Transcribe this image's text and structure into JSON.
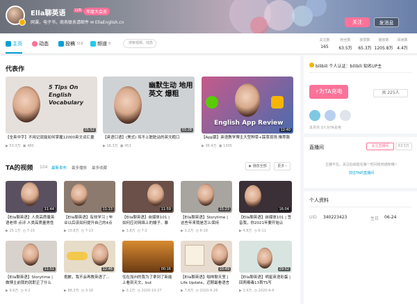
{
  "header": {
    "username": "Ella聊英语",
    "level": "LV6",
    "vip": "年度大会员",
    "bio": "网课，电子书，商务联系请邮件 ✉ EllaEnglish.cn",
    "follow_label": "关注",
    "message_label": "发消息"
  },
  "nav": {
    "tabs": [
      {
        "label": "主页",
        "count": ""
      },
      {
        "label": "动态",
        "count": ""
      },
      {
        "label": "投稿",
        "count": "318"
      },
      {
        "label": "频道",
        "count": "8"
      }
    ],
    "search_placeholder": "搜索视频、动态",
    "stats": [
      {
        "key": "关注数",
        "value": "165"
      },
      {
        "key": "粉丝数",
        "value": "63.5万"
      },
      {
        "key": "获赞数",
        "value": "65.3万"
      },
      {
        "key": "播放数",
        "value": "1205.8万"
      },
      {
        "key": "阅读数",
        "value": "4.4万"
      }
    ]
  },
  "featured": {
    "heading": "代表作",
    "items": [
      {
        "overlay": "5 Tips On English Vocabulary",
        "duration": "05:52",
        "title": "【全英中字】不用记就能如何掌握12000英文词汇量",
        "plays": "53.3万",
        "comments": "480"
      },
      {
        "overlay": "幽默生动 地用英文 爆粗",
        "duration": "03:28",
        "title": "【英语口语】(美式) 骂不上脏脏话的英文粗口",
        "plays": "16.3万",
        "comments": "453"
      },
      {
        "overlay": "English App Review",
        "duration": "12:40",
        "title": "【App篇】英语教学博主大型种草+踩草现场 推荐款",
        "plays": "36.4万",
        "comments": "1305"
      }
    ]
  },
  "videos": {
    "heading": "TA的视频",
    "count": "104",
    "tabs": [
      "最新发布",
      "最多播放",
      "最多收藏"
    ],
    "play_all": "▶ 播放全部",
    "more": "更多 ›",
    "items": [
      {
        "duration": "11:44",
        "title": "【Ella聊英语】人类高质量英语老师 点评 人类高质量男性",
        "plays": "25.1万",
        "date": "7-15"
      },
      {
        "duration": "11:13",
        "title": "【Ella聊英语】有效学习 | 毕业以后该如何提升自己的4点",
        "plays": "10.8万",
        "date": "7-13"
      },
      {
        "duration": "11:59",
        "title": "【Ella聊英语】自媒体101 | 如何应对网络上的嫂子、暴",
        "plays": "3.8万",
        "date": "7-2"
      },
      {
        "duration": "15:23",
        "title": "【Ella聊英语】Storytime | 这些年来我是怎么保持",
        "plays": "3.2万",
        "date": "6-18"
      },
      {
        "duration": "16:04",
        "title": "【Ella聊英语】自媒体101 | 签音我，你2021年要开始认",
        "plays": "4.8万",
        "date": "6-11"
      },
      {
        "duration": "11:51",
        "title": "【Ella聊英语】Storytime | 做博主前我的就职正了什么",
        "plays": "9.6万",
        "date": "4-2"
      },
      {
        "duration": "12:46",
        "title": "抱歉，我不会再教英语了...",
        "plays": "88.3万",
        "date": "3-18"
      },
      {
        "duration": "00:16",
        "title": "住在加州的我为了拿到了新能上看到天文，but",
        "plays": "3.2万",
        "date": "2020-10-27"
      },
      {
        "duration": "10:49",
        "title": "【Ella聊英语】咖啡聊天室 | Life Update，近期最看语言",
        "plays": "7.8万",
        "date": "2020-9-26"
      },
      {
        "duration": "29:52",
        "title": "【Ella聊英语】明星英语彩蛋 | 回两霉毒13首TS写",
        "plays": "3.9万",
        "date": "2020-9-4"
      }
    ]
  },
  "sidebar": {
    "cert": "bilibili 个人认证：bilibili 知名UP主",
    "charge_button": "为TA充电",
    "charge_count": "共 225人",
    "charge_note": "本月共 3人为TA充电",
    "live_heading": "直播间",
    "live_follow": "关注直播间",
    "live_fans": "63.5万",
    "live_status": "主播不在，关注后就能在第一时间收到通知哦~",
    "live_link": "前往TA的直播间",
    "profile_heading": "个人资料",
    "uid_label": "UID",
    "uid": "340223423",
    "birthday_label": "生日",
    "birthday": "06-24"
  },
  "colors": {
    "accent": "#00a1d6",
    "pink": "#fb7299"
  }
}
